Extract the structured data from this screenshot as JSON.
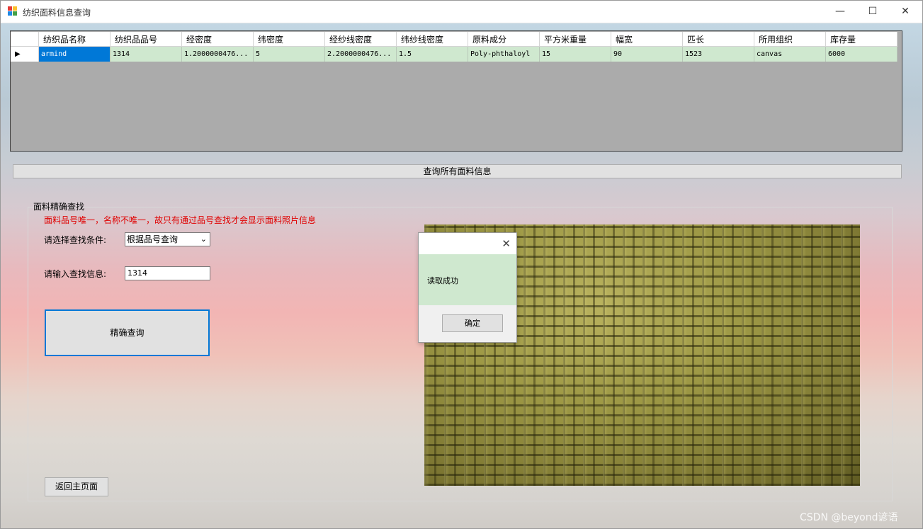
{
  "window": {
    "title": "纺织面料信息查询",
    "minimize_glyph": "—",
    "maximize_glyph": "☐",
    "close_glyph": "✕"
  },
  "grid": {
    "columns": [
      "纺织品名称",
      "纺织品品号",
      "经密度",
      "纬密度",
      "经纱线密度",
      "纬纱线密度",
      "原料成分",
      "平方米重量",
      "幅宽",
      "匹长",
      "所用组织",
      "库存量"
    ],
    "current_row_glyph": "▶",
    "rows": [
      [
        "armind",
        "1314",
        "1.2000000476...",
        "5",
        "2.2000000476...",
        "1.5",
        "Poly-phthaloyl",
        "15",
        "90",
        "1523",
        "canvas",
        "6000"
      ]
    ]
  },
  "query_all_label": "查询所有面料信息",
  "exact_search": {
    "group_title": "面料精确查找",
    "note": "面料品号唯一，名称不唯一，故只有通过品号查找才会显示面料照片信息",
    "condition_label": "请选择查找条件:",
    "condition_value": "根据品号查询",
    "info_label": "请输入查找信息:",
    "info_value": "1314",
    "exact_button": "精确查询",
    "back_button": "返回主页面"
  },
  "dialog": {
    "message": "读取成功",
    "ok_label": "确定",
    "close_glyph": "✕"
  },
  "watermark": "CSDN @beyond谚语",
  "colors": {
    "row_bg": "#cfe8cf",
    "selected_cell": "#0078d7",
    "note_red": "#e00000",
    "grid_bg": "#ababab"
  }
}
